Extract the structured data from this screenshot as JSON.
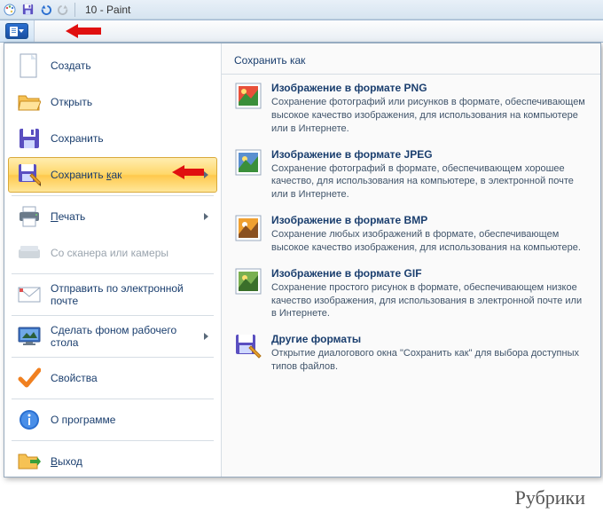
{
  "titlebar": {
    "doc_name": "10",
    "app": "Paint"
  },
  "menu": {
    "create": "Создать",
    "open": "Открыть",
    "save": "Сохранить",
    "save_as": "Сохранить как",
    "print": "Печать",
    "scanner": "Со сканера или камеры",
    "email": "Отправить по электронной почте",
    "desktop_bg": "Сделать фоном рабочего стола",
    "properties": "Свойства",
    "about": "О программе",
    "exit": "Выход"
  },
  "submenu": {
    "header": "Сохранить как",
    "png": {
      "title": "Изображение в формате PNG",
      "desc": "Сохранение фотографий или рисунков в формате, обеспечивающем высокое качество изображения, для использования на компьютере или в Интернете."
    },
    "jpeg": {
      "title": "Изображение в формате JPEG",
      "desc": "Сохранение фотографий в формате, обеспечивающем хорошее качество, для использования на компьютере, в электронной почте или в Интернете."
    },
    "bmp": {
      "title": "Изображение в формате BMP",
      "desc": "Сохранение любых изображений в формате, обеспечивающем высокое качество изображения, для использования на компьютере."
    },
    "gif": {
      "title": "Изображение в формате GIF",
      "desc": "Сохранение простого рисунок в формате, обеспечивающем низкое качество изображения, для использования в электронной почте или в Интернете."
    },
    "other": {
      "title": "Другие форматы",
      "desc": "Открытие диалогового окна \"Сохранить как\" для выбора доступных типов файлов."
    }
  },
  "footer": {
    "rubriki": "Рубрики"
  }
}
